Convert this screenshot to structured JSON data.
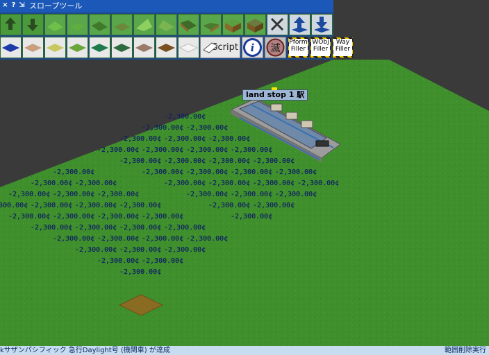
{
  "window": {
    "title": "スロープツール",
    "buttons": [
      "×",
      "?",
      "⇲"
    ]
  },
  "toolbar": {
    "script_label": "Script",
    "info_icon": "i",
    "destroy_icon": "滅",
    "fillers": [
      "Pform Filler",
      "WObj Filler",
      "Way Filler"
    ]
  },
  "station": {
    "label": "land stop 1 駅"
  },
  "cost_text": "-2,300.00¢",
  "status": {
    "message": "kサザンパシフィック 急行Daylight号 (機関車) が達成",
    "right": "範囲削除実行"
  },
  "colors": {
    "grass": "#3f8f2d",
    "background": "#3a3a3a",
    "toolbar": "#1b58b8"
  }
}
